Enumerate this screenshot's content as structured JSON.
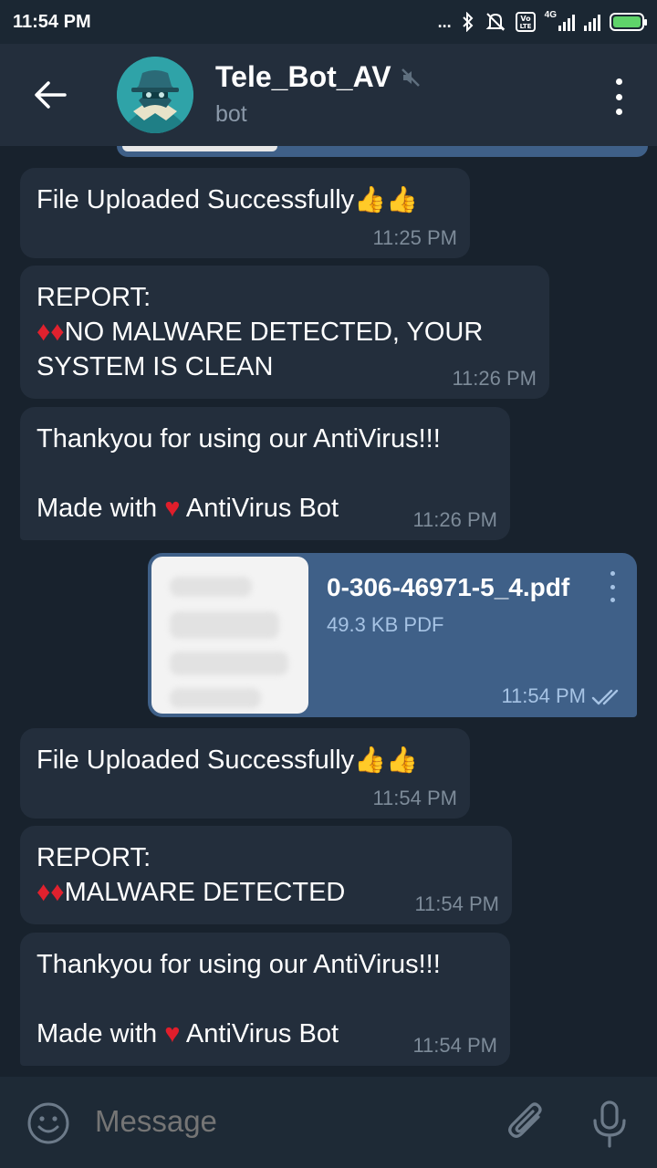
{
  "status_bar": {
    "time": "11:54 PM",
    "network": "4G",
    "volte": "Vo LTE",
    "more": "..."
  },
  "header": {
    "title": "Tele_Bot_AV",
    "subtitle": "bot",
    "muted": true
  },
  "messages": [
    {
      "id": "m1",
      "direction": "in",
      "text": "File Uploaded Successfully",
      "emoji": "👍👍",
      "time": "11:25 PM"
    },
    {
      "id": "m2",
      "direction": "in",
      "line1": "REPORT:",
      "diamonds": "♦♦",
      "line2": "NO MALWARE DETECTED, YOUR",
      "line3": "SYSTEM IS CLEAN",
      "time": "11:26 PM"
    },
    {
      "id": "m3",
      "direction": "in",
      "line1": "Thankyou for using our AntiVirus!!!",
      "line2_pre": "Made with ",
      "heart": "♥",
      "line2_post": " AntiVirus Bot",
      "time": "11:26 PM"
    },
    {
      "id": "m4",
      "direction": "out",
      "file_name": "0-306-46971-5_4.pdf",
      "file_meta": "49.3 KB PDF",
      "time": "11:54 PM",
      "read": true
    },
    {
      "id": "m5",
      "direction": "in",
      "text": "File Uploaded Successfully",
      "emoji": "👍👍",
      "time": "11:54 PM"
    },
    {
      "id": "m6",
      "direction": "in",
      "line1": "REPORT:",
      "diamonds": "♦♦",
      "line2": "MALWARE DETECTED",
      "time": "11:54 PM"
    },
    {
      "id": "m7",
      "direction": "in",
      "line1": "Thankyou for using our AntiVirus!!!",
      "line2_pre": "Made with ",
      "heart": "♥",
      "line2_post": " AntiVirus Bot",
      "time": "11:54 PM"
    }
  ],
  "input": {
    "placeholder": "Message"
  },
  "colors": {
    "background": "#18222d",
    "header": "#232e3c",
    "bubble_in": "#232e3c",
    "bubble_out": "#3f6088",
    "meta_in": "#7d8b99",
    "meta_out": "#a6c3e4",
    "avatar": "#2fa3a8"
  }
}
